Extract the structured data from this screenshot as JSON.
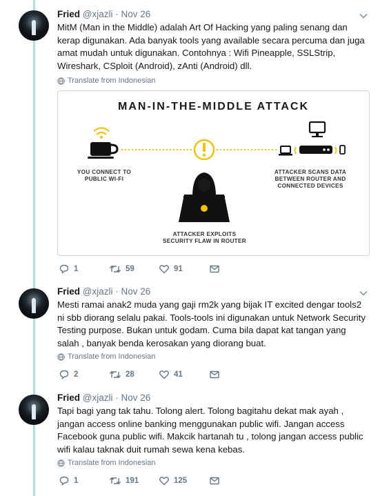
{
  "tweets": [
    {
      "name": "Fried",
      "handle": "@xjazli",
      "date": "· Nov 26",
      "text": "MitM (Man in the Middle) adalah Art Of Hacking yang paling senang dan kerap digunakan. Ada banyak tools yang available secara percuma dan juga amat mudah untuk digunakan. Contohnya : Wifi Pineapple, SSLStrip, Wireshark, CSploit (Android), zAnti (Android) dll.",
      "translate": "Translate from Indonesian",
      "replies": "1",
      "retweets": "59",
      "likes": "91"
    },
    {
      "name": "Fried",
      "handle": "@xjazli",
      "date": "· Nov 26",
      "text": "Mesti ramai anak2 muda yang gaji rm2k yang bijak IT excited dengar tools2 ni sbb diorang selalu pakai. Tools-tools ini digunakan untuk Network Security Testing purpose. Bukan untuk godam. Cuma bila dapat kat tangan yang salah , banyak benda kerosakan yang diorang buat.",
      "translate": "Translate from Indonesian",
      "replies": "2",
      "retweets": "28",
      "likes": "41"
    },
    {
      "name": "Fried",
      "handle": "@xjazli",
      "date": "· Nov 26",
      "text": "Tapi bagi yang tak tahu. Tolong alert. Tolong bagitahu dekat mak ayah , jangan access online banking menggunakan public wifi. Jangan access Facebook guna public wifi. Makcik hartanah tu , tolong jangan access public wifi kalau taknak duit rumah sewa kena kebas.",
      "translate": "Translate from Indonesian",
      "replies": "1",
      "retweets": "191",
      "likes": "125"
    }
  ],
  "media": {
    "title": "MAN-IN-THE-MIDDLE ATTACK",
    "caption_user_1": "YOU CONNECT TO",
    "caption_user_2": "PUBLIC WI-FI",
    "caption_router_1": "ATTACKER SCANS DATA",
    "caption_router_2": "BETWEEN ROUTER AND",
    "caption_router_3": "CONNECTED DEVICES",
    "caption_attacker_1": "ATTACKER EXPLOITS",
    "caption_attacker_2": "SECURITY FLAW IN ROUTER",
    "accent_color": "#f2c300"
  },
  "colors": {
    "thread_line": "#a8e5d6",
    "muted": "#657786"
  }
}
